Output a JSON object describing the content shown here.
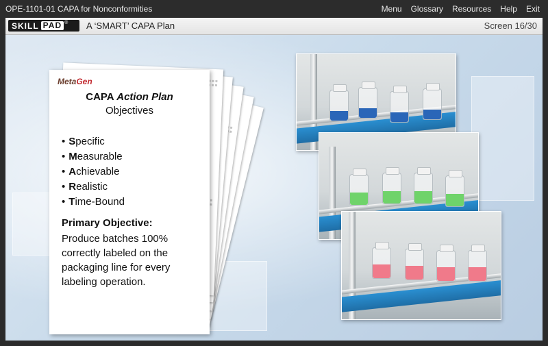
{
  "app": {
    "course_title": "OPE-1101-01 CAPA for Nonconformities",
    "nav": [
      "Menu",
      "Glossary",
      "Resources",
      "Help",
      "Exit"
    ]
  },
  "header": {
    "logo_part1": "SKILL",
    "logo_part2": "PAD",
    "logo_mark": "®",
    "screen_title": "A ‘SMART’ CAPA Plan",
    "screen_number": "Screen 16/30"
  },
  "document": {
    "brand_part1": "Meta",
    "brand_part2": "Gen",
    "title_main": "CAPA ",
    "title_italic": "Action Plan",
    "subtitle": "Objectives",
    "smart_items": [
      {
        "letter": "S",
        "rest": "pecific"
      },
      {
        "letter": "M",
        "rest": "easurable"
      },
      {
        "letter": "A",
        "rest": "chievable"
      },
      {
        "letter": "R",
        "rest": "ealistic"
      },
      {
        "letter": "T",
        "rest": "ime-Bound"
      }
    ],
    "primary_label": "Primary Objective:",
    "primary_text": "Produce batches 100% correctly labeled on the packaging line for every labeling operation."
  },
  "photos": [
    {
      "name": "blue-vials-photo",
      "liquid_color": "#2a66b8"
    },
    {
      "name": "green-vials-photo",
      "liquid_color": "#6fd36a"
    },
    {
      "name": "pink-vials-photo",
      "liquid_color": "#f07a8a"
    }
  ]
}
